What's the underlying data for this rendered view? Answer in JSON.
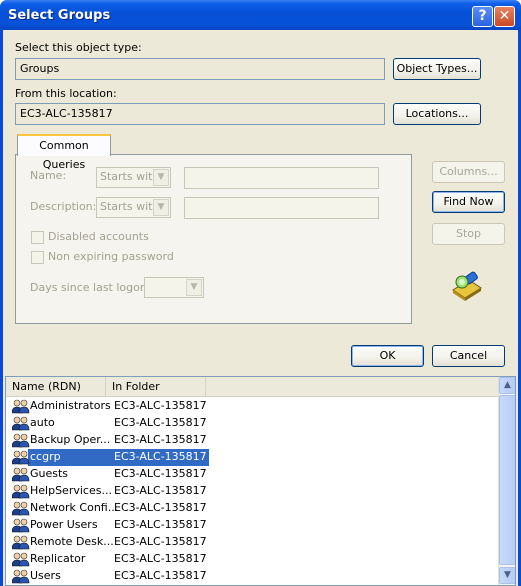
{
  "window": {
    "title": "Select Groups"
  },
  "object_type": {
    "label": "Select this object type:",
    "value": "Groups",
    "button": "Object Types..."
  },
  "location": {
    "label": "From this location:",
    "value": "EC3-ALC-135817",
    "button": "Locations..."
  },
  "queries": {
    "tab": "Common Queries",
    "name_label": "Name:",
    "description_label": "Description:",
    "starts_with": "Starts with",
    "disabled_accounts": "Disabled accounts",
    "non_expiring": "Non expiring password",
    "days_since": "Days since last logon:"
  },
  "side_buttons": {
    "columns": "Columns...",
    "find_now": "Find Now",
    "stop": "Stop"
  },
  "footer": {
    "ok": "OK",
    "cancel": "Cancel"
  },
  "results": {
    "columns": [
      "Name (RDN)",
      "In Folder"
    ],
    "rows": [
      {
        "name": "Administrators",
        "folder": "EC3-ALC-135817"
      },
      {
        "name": "auto",
        "folder": "EC3-ALC-135817"
      },
      {
        "name": "Backup Oper...",
        "folder": "EC3-ALC-135817"
      },
      {
        "name": "ccgrp",
        "folder": "EC3-ALC-135817",
        "selected": true
      },
      {
        "name": "Guests",
        "folder": "EC3-ALC-135817"
      },
      {
        "name": "HelpServices...",
        "folder": "EC3-ALC-135817"
      },
      {
        "name": "Network Confi...",
        "folder": "EC3-ALC-135817"
      },
      {
        "name": "Power Users",
        "folder": "EC3-ALC-135817"
      },
      {
        "name": "Remote Desk...",
        "folder": "EC3-ALC-135817"
      },
      {
        "name": "Replicator",
        "folder": "EC3-ALC-135817"
      },
      {
        "name": "Users",
        "folder": "EC3-ALC-135817"
      }
    ]
  },
  "icons": {
    "group": "group-icon",
    "search_flashlight": "search-flashlight-icon"
  },
  "colors": {
    "title_blue": "#0552d8",
    "selection": "#316ac5",
    "dialog_bg": "#ece9d8"
  }
}
